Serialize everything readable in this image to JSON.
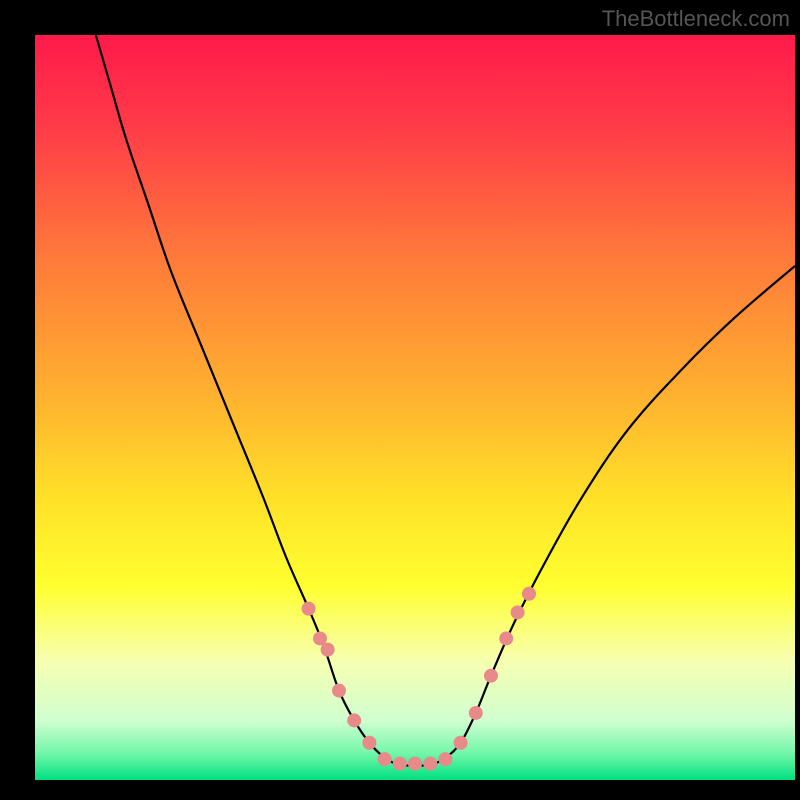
{
  "watermark": "TheBottleneck.com",
  "chart_data": {
    "type": "line",
    "title": "",
    "xlabel": "",
    "ylabel": "",
    "xlim": [
      0,
      100
    ],
    "ylim": [
      0,
      100
    ],
    "background_gradient": {
      "stops": [
        {
          "offset": 0.0,
          "color": "#ff1a4a"
        },
        {
          "offset": 0.12,
          "color": "#ff3a48"
        },
        {
          "offset": 0.3,
          "color": "#ff7a3a"
        },
        {
          "offset": 0.48,
          "color": "#ffb030"
        },
        {
          "offset": 0.62,
          "color": "#ffe028"
        },
        {
          "offset": 0.74,
          "color": "#ffff30"
        },
        {
          "offset": 0.84,
          "color": "#f7ffb0"
        },
        {
          "offset": 0.92,
          "color": "#d0ffd0"
        },
        {
          "offset": 0.965,
          "color": "#70f7a8"
        },
        {
          "offset": 1.0,
          "color": "#00e080"
        }
      ]
    },
    "series": [
      {
        "name": "bottleneck-curve",
        "color": "#000000",
        "x": [
          8,
          10,
          12,
          15,
          18,
          22,
          26,
          30,
          33,
          36,
          38,
          40,
          42,
          44,
          46,
          48,
          50,
          52,
          54,
          56,
          58,
          60,
          63,
          67,
          72,
          78,
          85,
          92,
          100
        ],
        "y": [
          100,
          93,
          86,
          77,
          68,
          58,
          48,
          38,
          30,
          23,
          18,
          12,
          8,
          5,
          3,
          2,
          2,
          2,
          3,
          5,
          9,
          14,
          21,
          29,
          38,
          47,
          55,
          62,
          69
        ]
      }
    ],
    "markers": {
      "name": "highlight-dots",
      "color": "#e88a8a",
      "radius": 7,
      "points": [
        {
          "x": 36,
          "y": 23
        },
        {
          "x": 37.5,
          "y": 19
        },
        {
          "x": 38.5,
          "y": 17.5
        },
        {
          "x": 40,
          "y": 12
        },
        {
          "x": 42,
          "y": 8
        },
        {
          "x": 44,
          "y": 5
        },
        {
          "x": 46,
          "y": 2.8
        },
        {
          "x": 48,
          "y": 2.2
        },
        {
          "x": 50,
          "y": 2.2
        },
        {
          "x": 52,
          "y": 2.2
        },
        {
          "x": 54,
          "y": 2.8
        },
        {
          "x": 56,
          "y": 5
        },
        {
          "x": 58,
          "y": 9
        },
        {
          "x": 60,
          "y": 14
        },
        {
          "x": 62,
          "y": 19
        },
        {
          "x": 63.5,
          "y": 22.5
        },
        {
          "x": 65,
          "y": 25
        }
      ]
    }
  }
}
